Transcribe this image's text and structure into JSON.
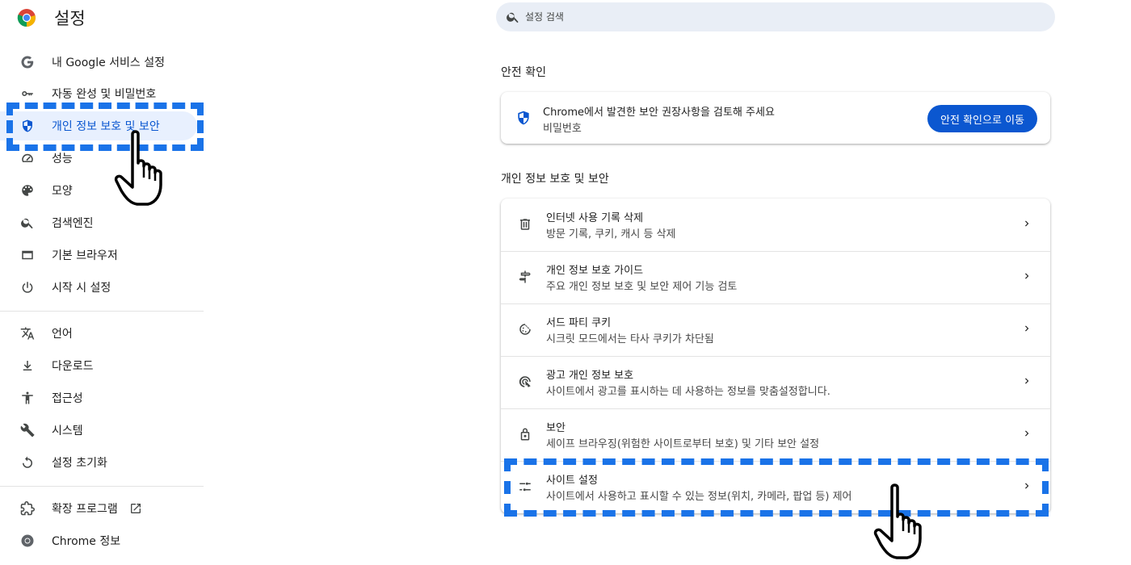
{
  "app": {
    "title": "설정"
  },
  "sidebar": {
    "items": [
      {
        "label": "내 Google 서비스 설정",
        "icon": "google-g-icon"
      },
      {
        "label": "자동 완성 및 비밀번호",
        "icon": "key-icon"
      },
      {
        "label": "개인 정보 보호 및 보안",
        "icon": "shield-icon",
        "active": true
      },
      {
        "label": "성능",
        "icon": "speedometer-icon"
      },
      {
        "label": "모양",
        "icon": "palette-icon"
      },
      {
        "label": "검색엔진",
        "icon": "search-icon"
      },
      {
        "label": "기본 브라우저",
        "icon": "browser-window-icon"
      },
      {
        "label": "시작 시 설정",
        "icon": "power-icon"
      },
      {
        "label": "언어",
        "icon": "translate-icon"
      },
      {
        "label": "다운로드",
        "icon": "download-icon"
      },
      {
        "label": "접근성",
        "icon": "accessibility-icon"
      },
      {
        "label": "시스템",
        "icon": "wrench-icon"
      },
      {
        "label": "설정 초기화",
        "icon": "reset-icon"
      },
      {
        "label": "확장 프로그램",
        "icon": "puzzle-icon"
      },
      {
        "label": "Chrome 정보",
        "icon": "chrome-logo-icon"
      }
    ]
  },
  "search": {
    "placeholder": "설정 검색"
  },
  "safety_check": {
    "section_title": "안전 확인",
    "title": "Chrome에서 발견한 보안 권장사항을 검토해 주세요",
    "subtitle": "비밀번호",
    "button_label": "안전 확인으로 이동"
  },
  "privacy": {
    "section_title": "개인 정보 보호 및 보안",
    "rows": [
      {
        "title": "인터넷 사용 기록 삭제",
        "subtitle": "방문 기록, 쿠키, 캐시 등 삭제",
        "icon": "trash-icon"
      },
      {
        "title": "개인 정보 보호 가이드",
        "subtitle": "주요 개인 정보 보호 및 보안 제어 기능 검토",
        "icon": "signpost-icon"
      },
      {
        "title": "서드 파티 쿠키",
        "subtitle": "시크릿 모드에서는 타사 쿠키가 차단됨",
        "icon": "cookie-icon"
      },
      {
        "title": "광고 개인 정보 보호",
        "subtitle": "사이트에서 광고를 표시하는 데 사용하는 정보를 맞춤설정합니다.",
        "icon": "ad-target-icon"
      },
      {
        "title": "보안",
        "subtitle": "세이프 브라우징(위험한 사이트로부터 보호) 및 기타 보안 설정",
        "icon": "lock-icon"
      },
      {
        "title": "사이트 설정",
        "subtitle": "사이트에서 사용하고 표시할 수 있는 정보(위치, 카메라, 팝업 등) 제어",
        "icon": "sliders-icon"
      }
    ]
  },
  "colors": {
    "accent": "#0b57d0",
    "active_bg": "#e8f0fe",
    "annotation": "#1a73e8"
  }
}
